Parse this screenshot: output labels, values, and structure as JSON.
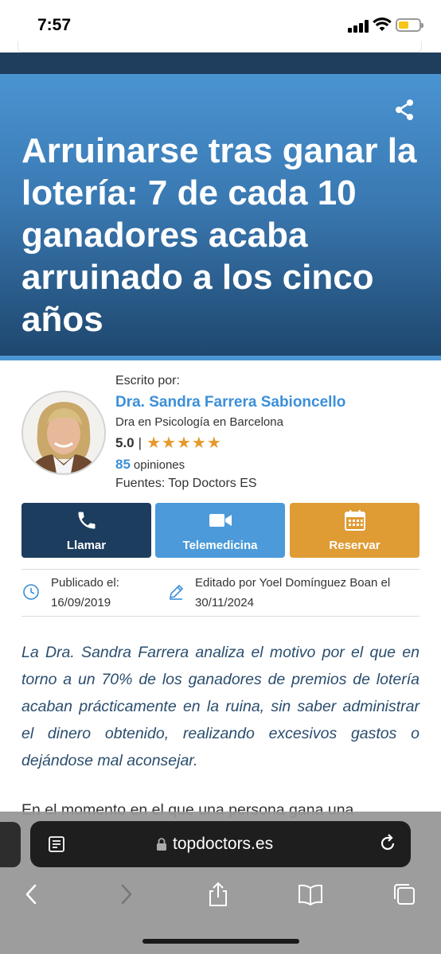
{
  "status_bar": {
    "time": "7:57",
    "battery_level": 0.35,
    "battery_color": "#f5c518"
  },
  "hero": {
    "title": "Arruinarse tras ganar la lotería: 7 de cada 10 ganadores acaba arruinado a los cinco años",
    "share_icon": "share-icon"
  },
  "author": {
    "written_by_label": "Escrito por:",
    "name": "Dra. Sandra Farrera Sabioncello",
    "specialty": "Dra en Psicología en Barcelona",
    "rating": "5.0",
    "rating_separator": "|",
    "stars": 5,
    "reviews_count": "85",
    "reviews_label": "opiniones",
    "sources": "Fuentes: Top Doctors ES"
  },
  "actions": {
    "call_label": "Llamar",
    "tele_label": "Telemedicina",
    "book_label": "Reservar",
    "colors": {
      "call": "#1c3d5e",
      "tele": "#4c9ad9",
      "book": "#df9b34"
    }
  },
  "meta": {
    "published_label": "Publicado el:",
    "published_date": "16/09/2019",
    "edited_line1": "Editado por Yoel Domínguez Boan el",
    "edited_line2": "30/11/2024"
  },
  "article": {
    "intro": "La Dra. Sandra Farrera analiza el motivo por el que en torno a un 70% de los ganadores de premios de lotería acaban prácticamente en la ruina, sin saber administrar el dinero obtenido, realizando excesivos gastos o dejándose mal aconsejar.",
    "body_start": "En el momento en el que una persona gana una"
  },
  "browser": {
    "url": "topdoctors.es",
    "icons": [
      "reader-icon",
      "lock-icon",
      "reload-icon",
      "back-icon",
      "forward-icon",
      "share-icon",
      "bookmarks-icon",
      "tabs-icon"
    ]
  }
}
